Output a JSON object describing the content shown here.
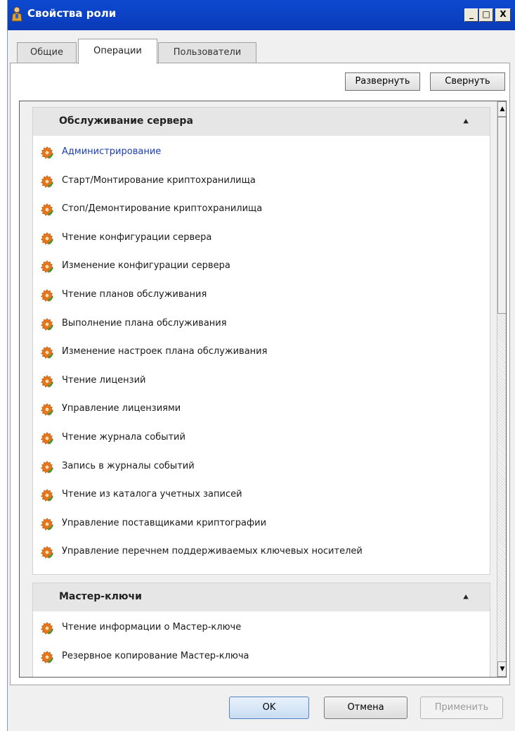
{
  "window": {
    "title": "Свойства роли",
    "min_label": "_",
    "max_label": "□",
    "close_label": "X"
  },
  "tabs": [
    {
      "label": "Общие"
    },
    {
      "label": "Операции",
      "active": true
    },
    {
      "label": "Пользователи"
    }
  ],
  "toolbar": {
    "expand_label": "Развернуть",
    "collapse_label": "Свернуть"
  },
  "groups": [
    {
      "title": "Обслуживание сервера",
      "items": [
        {
          "label": "Администрирование"
        },
        {
          "label": "Старт/Монтирование криптохранилища"
        },
        {
          "label": "Стоп/Демонтирование криптохранилища"
        },
        {
          "label": "Чтение конфигурации сервера"
        },
        {
          "label": "Изменение конфигурации сервера"
        },
        {
          "label": "Чтение планов обслуживания"
        },
        {
          "label": "Выполнение плана обслуживания"
        },
        {
          "label": "Изменение настроек плана обслуживания"
        },
        {
          "label": "Чтение лицензий"
        },
        {
          "label": "Управление лицензиями"
        },
        {
          "label": "Чтение журнала событий"
        },
        {
          "label": "Запись в журналы событий"
        },
        {
          "label": "Чтение из каталога учетных записей"
        },
        {
          "label": "Управление поставщиками криптографии"
        },
        {
          "label": "Управление перечнем поддерживаемых ключевых носителей"
        }
      ]
    },
    {
      "title": "Мастер-ключи",
      "items": [
        {
          "label": "Чтение информации о Мастер-ключе"
        },
        {
          "label": "Резервное копирование Мастер-ключа"
        }
      ]
    }
  ],
  "buttons": {
    "ok": "OK",
    "cancel": "Отмена",
    "apply": "Применить"
  },
  "colors": {
    "titlebar": "#0a3ab8",
    "gear": "#e8761a",
    "link": "#1a3fb0"
  },
  "icons": {
    "app": "role-icon",
    "item": "gear-icon"
  }
}
